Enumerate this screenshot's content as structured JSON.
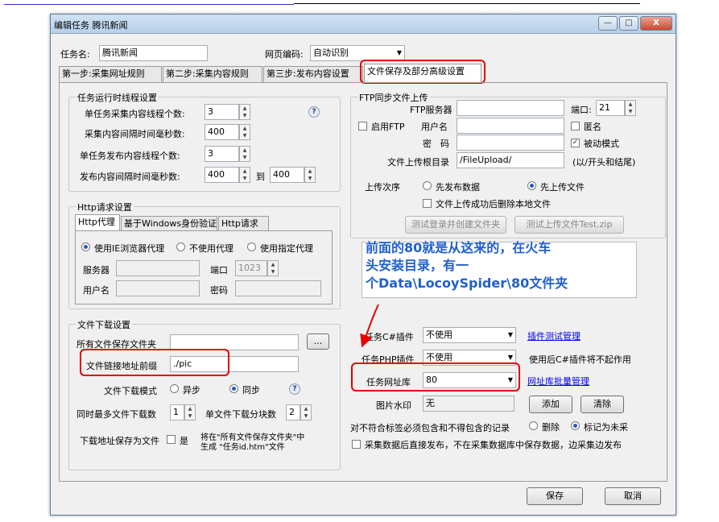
{
  "window": {
    "title": "编辑任务 腾讯新闻",
    "min_label": "—",
    "max_label": "□",
    "close_label": "X"
  },
  "header": {
    "task_name_label": "任务名:",
    "task_name_value": "腾讯新闻",
    "encoding_label": "网页编码:",
    "encoding_value": "自动识别"
  },
  "tabs": [
    {
      "label": "第一步:采集网址规则"
    },
    {
      "label": "第二步:采集内容规则"
    },
    {
      "label": "第三步:发布内容设置"
    },
    {
      "label": "文件保存及部分高级设置"
    }
  ],
  "thread_group": {
    "title": "任务运行时线程设置",
    "rows": [
      {
        "label": "单任务采集内容线程个数:",
        "value": "3"
      },
      {
        "label": "采集内容间隔时间毫秒数:",
        "value": "400"
      },
      {
        "label": "单任务发布内容线程个数:",
        "value": "3"
      },
      {
        "label": "发布内容间隔时间毫秒数:",
        "value": "400"
      }
    ],
    "to_label": "到",
    "to_value": "400"
  },
  "http_group": {
    "title": "Http请求设置",
    "tabs": [
      "Http代理",
      "基于Windows身份验证",
      "Http请求"
    ],
    "radios": [
      "使用IE浏览器代理",
      "不使用代理",
      "使用指定代理"
    ],
    "server_label": "服务器",
    "port_label": "端口",
    "port_value": "1023",
    "user_label": "用户名",
    "password_label": "密码"
  },
  "download_group": {
    "title": "文件下载设置",
    "folder_label": "所有文件保存文件夹",
    "browse_label": "...",
    "prefix_label": "文件链接地址前缀",
    "prefix_value": "./pic",
    "mode_label": "文件下载模式",
    "async_label": "异步",
    "sync_label": "同步",
    "max_label": "同时最多文件下载数",
    "max_value": "1",
    "chunks_label": "单文件下载分块数",
    "chunks_value": "2",
    "save_as_label": "下载地址保存为文件",
    "yes_label": "是",
    "save_as_note_1": "将在\"所有文件保存文件夹\"中",
    "save_as_note_2": "生成 \"任务id.htm\"文件"
  },
  "ftp_group": {
    "title": "FTP同步文件上传",
    "server_label": "FTP服务器",
    "port_label": "端口:",
    "port_value": "21",
    "enable_label": "启用FTP",
    "user_label": "用户名",
    "anon_label": "匿名",
    "password_label": "密　码",
    "passive_label": "被动模式",
    "root_label": "文件上传根目录",
    "root_value": "/FileUpload/",
    "root_note": "(以/开头和结尾)",
    "order_label": "上传次序",
    "order_opt1": "先发布数据",
    "order_opt2": "先上传文件",
    "delete_label": "文件上传成功后删除本地文件",
    "test_button": "测试登录并创建文件夹",
    "test_zip_button": "测试上传文件Test.zip"
  },
  "annotation": {
    "line1": "前面的80就是从这来的，在火车",
    "line2": "头安装目录，有一",
    "line3": "个Data\\LocoySpider\\80文件夹"
  },
  "plugins": {
    "cs_label": "任务C#插件",
    "cs_value": "不使用",
    "cs_link": "插件测试管理",
    "php_label": "任务PHP插件",
    "php_value": "不使用",
    "php_note": "使用后C#插件将不起作用",
    "db_label": "任务网址库",
    "db_value": "80",
    "db_link": "网址库批量管理",
    "watermark_label": "图片水印",
    "watermark_value": "无",
    "add_button": "添加",
    "clear_button": "清除"
  },
  "bottom_opts": {
    "mismatch_label": "对不符合标签必须包含和不得包含的记录",
    "delete_label": "删除",
    "mark_label": "标记为未采",
    "direct_publish_label": "采集数据后直接发布，不在采集数据库中保存数据，边采集边发布"
  },
  "footer": {
    "save_button": "保存",
    "cancel_button": "取消"
  },
  "colors": {
    "highlight": "#e60000",
    "annotation": "#1f5fcf",
    "link": "#0000ee"
  }
}
